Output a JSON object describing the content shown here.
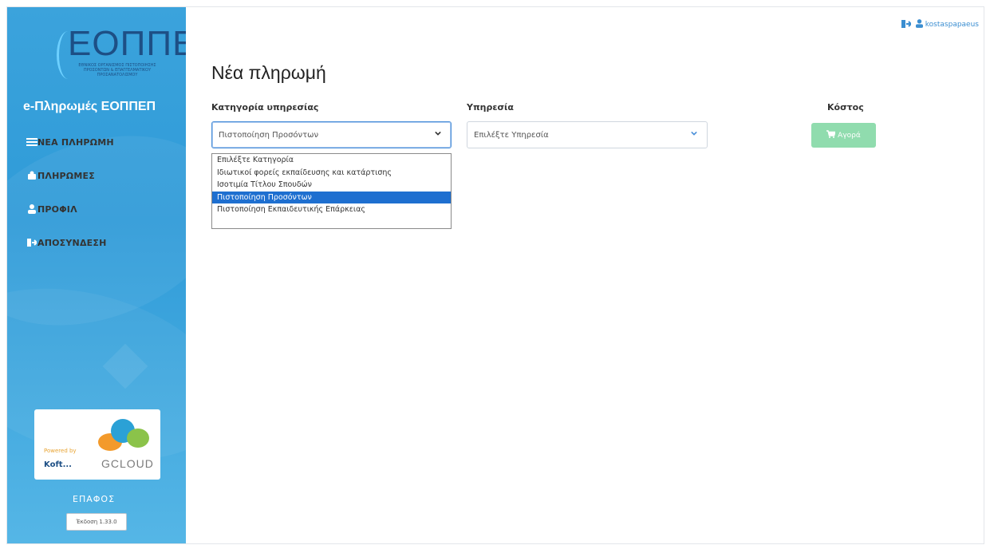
{
  "brand": {
    "logo_text": "ΕΟΠΠΕΠ",
    "logo_sub": "ΕΘΝΙΚΟΣ ΟΡΓΑΝΙΣΜΟΣ ΠΙΣΤΟΠΟΙΗΣΗΣ ΠΡΟΣΟΝΤΩΝ & ΕΠΑΓΓΕΛΜΑΤΙΚΟΥ ΠΡΟΣΑΝΑΤΟΛΙΣΜΟΥ",
    "app_title": "e-Πληρωμές ΕΟΠΠΕΠ"
  },
  "sidebar": {
    "items": [
      {
        "label": "ΝΕΑ ΠΛΗΡΩΜΗ",
        "icon": "list-icon"
      },
      {
        "label": "ΠΛΗΡΩΜΕΣ",
        "icon": "money-icon"
      },
      {
        "label": "ΠΡΟΦΙΛ",
        "icon": "user-icon"
      },
      {
        "label": "ΑΠΟΣΥΝΔΕΣΗ",
        "icon": "logout-icon"
      }
    ],
    "powered_by": "Powered by",
    "partner1": "Koft...",
    "partner2": "GCLOUD",
    "enaosis": "ΕΠΑΦΟΣ",
    "version": "Έκδοση 1.33.0"
  },
  "header": {
    "username": "kostaspapaeus"
  },
  "main": {
    "title": "Νέα πληρωμή",
    "category": {
      "label": "Κατηγορία υπηρεσίας",
      "value": "Πιστοποίηση Προσόντων",
      "options": [
        "Επιλέξτε Κατηγορία",
        "Ιδιωτικοί φορείς εκπαίδευσης και κατάρτισης",
        "Ισοτιμία Τίτλου Σπουδών",
        "Πιστοποίηση Προσόντων",
        "Πιστοποίηση Εκπαιδευτικής Επάρκειας"
      ],
      "selected_index": 3
    },
    "service": {
      "label": "Υπηρεσία",
      "placeholder": "Επιλέξτε Υπηρεσία"
    },
    "cost": {
      "label": "Κόστος",
      "button": "Αγορά"
    }
  },
  "colors": {
    "sidebar": "#2f9bd8",
    "buy_button": "#7dd6a0",
    "selected_option": "#1e6fd0",
    "link": "#3b8ed1"
  }
}
